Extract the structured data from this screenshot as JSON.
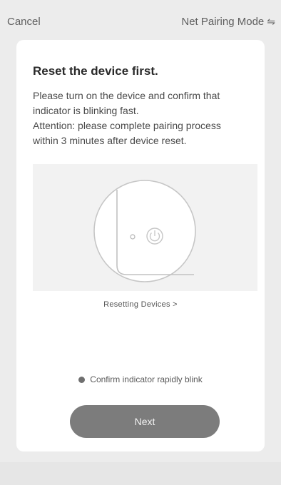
{
  "header": {
    "cancel_label": "Cancel",
    "mode_label": "Net Pairing Mode",
    "mode_icon": "⇋"
  },
  "card": {
    "title": "Reset the device first.",
    "description": [
      "Please turn on the device and confirm that indicator is blinking fast.",
      "Attention: please complete pairing process within 3 minutes after device reset."
    ],
    "reset_link": "Resetting Devices >",
    "confirm_label": "Confirm indicator rapidly blink",
    "next_label": "Next"
  },
  "colors": {
    "background": "#ececec",
    "card": "#ffffff",
    "button": "#7c7c7c",
    "text_primary": "#2a2a2a",
    "text_secondary": "#4a4a4a"
  },
  "icons": {
    "mode_toggle": "swap-arrows-icon",
    "illustration_power": "power-icon",
    "confirm_radio": "radio-dot-icon"
  }
}
